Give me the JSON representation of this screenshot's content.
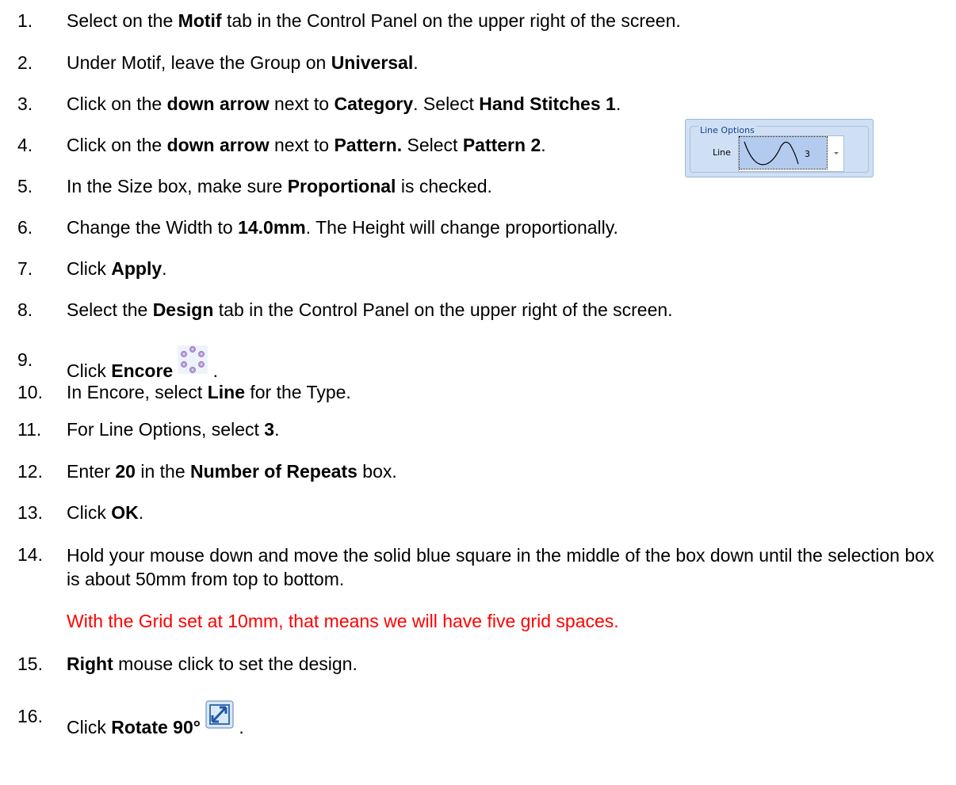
{
  "steps": [
    {
      "num": "1.",
      "parts": [
        "Select on the ",
        "Motif",
        " tab in the Control Panel on the upper right of the screen."
      ]
    },
    {
      "num": "2.",
      "parts": [
        "Under Motif, leave the Group on ",
        "Universal",
        "."
      ]
    },
    {
      "num": "3.",
      "parts": [
        "Click on the ",
        "down arrow",
        " next to ",
        "Category",
        ". Select ",
        "Hand Stitches 1",
        "."
      ]
    },
    {
      "num": "4.",
      "parts": [
        "Click on the ",
        "down arrow",
        " next to ",
        "Pattern.",
        " Select ",
        "Pattern 2",
        "."
      ]
    },
    {
      "num": "5.",
      "parts": [
        "In the Size box, make sure ",
        "Proportional",
        " is checked."
      ]
    },
    {
      "num": "6.",
      "parts": [
        "Change the Width to ",
        "14.0mm",
        ". The Height will change proportionally."
      ]
    },
    {
      "num": "7.",
      "parts": [
        "Click ",
        "Apply",
        "."
      ]
    },
    {
      "num": "8.",
      "parts": [
        "Select the ",
        "Design",
        " tab in the Control Panel on the upper right of the screen."
      ]
    },
    {
      "num": "9.",
      "parts": [
        "Click ",
        "Encore",
        " ."
      ]
    },
    {
      "num": "10.",
      "parts": [
        "In Encore, select ",
        "Line",
        " for the Type."
      ]
    },
    {
      "num": "11.",
      "parts": [
        "For Line Options, select ",
        "3",
        "."
      ]
    },
    {
      "num": "12.",
      "parts": [
        "Enter ",
        "20",
        " in the ",
        "Number of Repeats",
        " box."
      ]
    },
    {
      "num": "13.",
      "parts": [
        "Click ",
        "OK",
        "."
      ]
    },
    {
      "num": "14.",
      "parts": [
        "Hold your mouse down and move the solid blue square in the middle of the box down until the selection box is about 50mm from top to bottom."
      ]
    },
    {
      "num": "15.",
      "parts": [
        "",
        "Right",
        " mouse click to set the design."
      ]
    },
    {
      "num": "16.",
      "parts": [
        "Click ",
        "Rotate 90°",
        " ."
      ]
    }
  ],
  "note": "With the Grid set at 10mm, that means we will have five grid spaces.",
  "line_options": {
    "legend": "Line Options",
    "label": "Line",
    "value": "3"
  },
  "icons": {
    "encore": "encore-flower-ring-icon",
    "rotate": "rotate-90-icon"
  },
  "colors": {
    "text": "#000000",
    "note": "#ff0000",
    "panel_bg": "#cfe0f5",
    "legend_text": "#15428b"
  }
}
